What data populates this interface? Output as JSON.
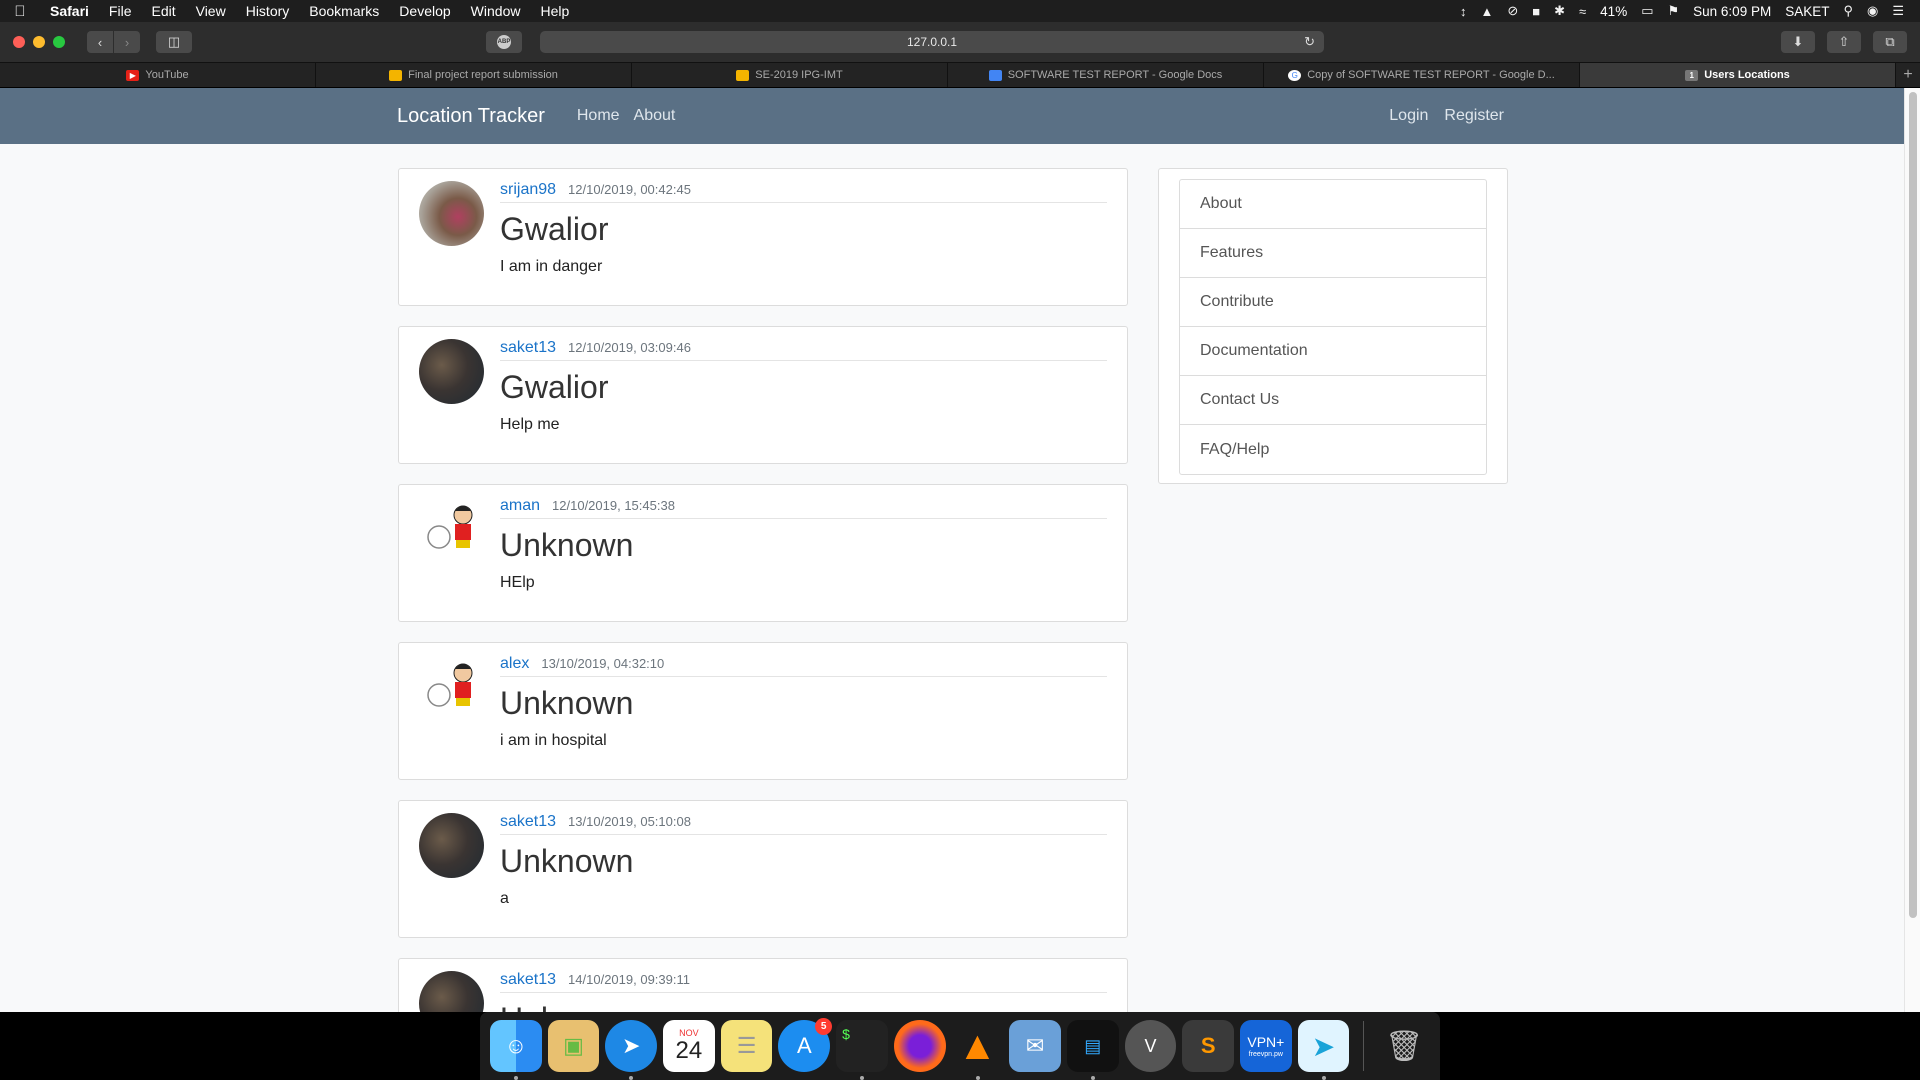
{
  "menubar": {
    "apple_icon": "apple-icon",
    "app_name": "Safari",
    "menus": [
      "File",
      "Edit",
      "View",
      "History",
      "Bookmarks",
      "Develop",
      "Window",
      "Help"
    ],
    "battery": "41%",
    "clock": "Sun 6:09 PM",
    "user": "SAKET"
  },
  "browser": {
    "url": "127.0.0.1",
    "abp_label": "ABP",
    "tabs": [
      {
        "title": "YouTube",
        "icon_color": "#e62117"
      },
      {
        "title": "Final project report submission",
        "icon_color": "#f4b400"
      },
      {
        "title": "SE-2019 IPG-IMT",
        "icon_color": "#f4b400"
      },
      {
        "title": "SOFTWARE TEST REPORT - Google Docs",
        "icon_color": "#4285f4"
      },
      {
        "title": "Copy of SOFTWARE TEST REPORT - Google D...",
        "icon_color": "#ffffff"
      },
      {
        "title": "Users Locations",
        "icon_color": "#777777",
        "icon_text": "1"
      }
    ]
  },
  "site": {
    "brand": "Location Tracker",
    "nav": {
      "home": "Home",
      "about": "About",
      "login": "Login",
      "register": "Register"
    },
    "posts": [
      {
        "user": "srijan98",
        "date": "12/10/2019, 00:42:45",
        "title": "Gwalior",
        "text": "I am in danger",
        "avatar": "photo1"
      },
      {
        "user": "saket13",
        "date": "12/10/2019, 03:09:46",
        "title": "Gwalior",
        "text": "Help me",
        "avatar": "photo"
      },
      {
        "user": "aman",
        "date": "12/10/2019, 15:45:38",
        "title": "Unknown",
        "text": "HElp",
        "avatar": "cartoon"
      },
      {
        "user": "alex",
        "date": "13/10/2019, 04:32:10",
        "title": "Unknown",
        "text": "i am in hospital",
        "avatar": "cartoon"
      },
      {
        "user": "saket13",
        "date": "13/10/2019, 05:10:08",
        "title": "Unknown",
        "text": "a",
        "avatar": "photo"
      },
      {
        "user": "saket13",
        "date": "14/10/2019, 09:39:11",
        "title": "Unknown",
        "text": "",
        "avatar": "photo"
      }
    ],
    "sidebar": [
      "About",
      "Features",
      "Contribute",
      "Documentation",
      "Contact Us",
      "FAQ/Help"
    ]
  },
  "dock": {
    "apps": [
      {
        "name": "finder-icon",
        "color": "#2b8cf2",
        "running": true
      },
      {
        "name": "preview-icon",
        "color": "#e8c070",
        "running": false
      },
      {
        "name": "safari-icon",
        "color": "#1e88e5",
        "running": true
      },
      {
        "name": "calendar-icon",
        "color": "#ffffff",
        "running": false,
        "label_month": "NOV",
        "label_day": "24"
      },
      {
        "name": "notes-icon",
        "color": "#f5e27a",
        "running": false
      },
      {
        "name": "app-store-icon",
        "color": "#1c8df0",
        "running": false,
        "badge": "5"
      },
      {
        "name": "terminal-icon",
        "color": "#222222",
        "running": true,
        "label": "$"
      },
      {
        "name": "firefox-icon",
        "color": "#ff6a1a",
        "running": false
      },
      {
        "name": "vlc-icon",
        "color": "#ff8800",
        "running": true
      },
      {
        "name": "mail-icon",
        "color": "#6aa0d8",
        "running": false
      },
      {
        "name": "activity-monitor-icon",
        "color": "#111111",
        "running": true
      },
      {
        "name": "vpn-client-icon",
        "color": "#555555",
        "running": false,
        "label": "V"
      },
      {
        "name": "sublime-text-icon",
        "color": "#3a3a3a",
        "running": false,
        "label": "S"
      },
      {
        "name": "vpn-plus-icon",
        "color": "#1565d8",
        "running": false,
        "label": "VPN+",
        "sublabel": "freevpn.pw"
      },
      {
        "name": "migration-icon",
        "color": "#e0f4ff",
        "running": true
      },
      {
        "name": "trash-icon",
        "color": "#2a2a2a",
        "running": false
      }
    ]
  }
}
